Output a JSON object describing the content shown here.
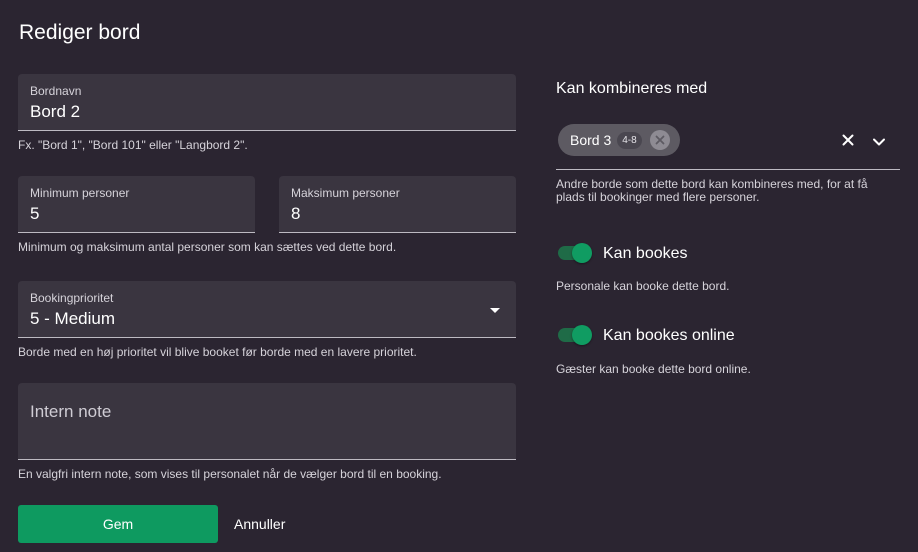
{
  "page": {
    "title": "Rediger bord"
  },
  "form": {
    "name": {
      "label": "Bordnavn",
      "value": "Bord 2",
      "helper": "Fx. \"Bord 1\", \"Bord 101\" eller \"Langbord 2\"."
    },
    "min_persons": {
      "label": "Minimum personer",
      "value": "5"
    },
    "max_persons": {
      "label": "Maksimum personer",
      "value": "8"
    },
    "persons_helper": "Minimum og maksimum antal personer som kan sættes ved dette bord.",
    "priority": {
      "label": "Bookingprioritet",
      "value": "5 - Medium",
      "helper": "Borde med en høj prioritet vil blive booket før borde med en lavere prioritet."
    },
    "note": {
      "placeholder": "Intern note",
      "helper": "En valgfri intern note, som vises til personalet når de vælger bord til en booking."
    },
    "save_label": "Gem",
    "cancel_label": "Annuller"
  },
  "combine": {
    "title": "Kan kombineres med",
    "chips": [
      {
        "label": "Bord 3",
        "badge": "4-8"
      }
    ],
    "helper_line1": "Andre borde som dette bord kan kombineres med, for at få",
    "helper_line2": "plads til bookinger med flere personer."
  },
  "bookable": {
    "label": "Kan bookes",
    "helper": "Personale kan booke dette bord.",
    "enabled": true
  },
  "bookable_online": {
    "label": "Kan bookes online",
    "helper": "Gæster kan booke dette bord online.",
    "enabled": true
  },
  "colors": {
    "background": "#2b2531",
    "field": "#3a3540",
    "primary": "#0e9a60",
    "toggle_track": "#1f6b47",
    "chip": "#5d5a62"
  },
  "icons": {
    "dropdown": "triangle-down-icon",
    "chip_remove": "circle-x-icon",
    "clear": "close-icon",
    "expand": "chevron-down-icon"
  }
}
